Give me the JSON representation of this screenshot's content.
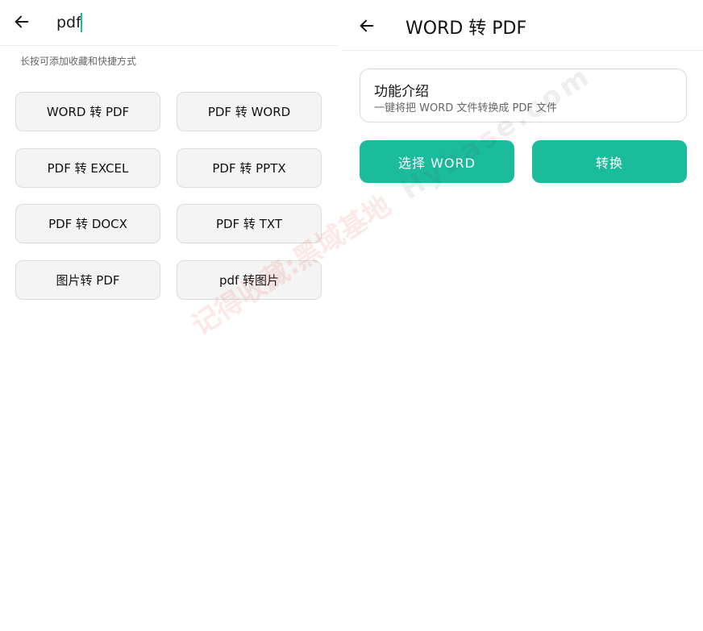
{
  "search": {
    "query": "pdf",
    "hint": "长按可添加收藏和快捷方式",
    "back_icon": "arrow-left-icon",
    "results": [
      {
        "label": "WORD 转 PDF"
      },
      {
        "label": "PDF 转 WORD"
      },
      {
        "label": "PDF 转 EXCEL"
      },
      {
        "label": "PDF 转 PPTX"
      },
      {
        "label": "PDF 转 DOCX"
      },
      {
        "label": "PDF 转 TXT"
      },
      {
        "label": "图片转 PDF"
      },
      {
        "label": "pdf 转图片"
      }
    ]
  },
  "converter": {
    "title": "WORD 转 PDF",
    "back_icon": "arrow-left-icon",
    "intro_title": "功能介绍",
    "intro_desc": "一键将把 WORD 文件转换成 PDF 文件",
    "select_label": "选择 WORD",
    "convert_label": "转换"
  },
  "watermark": {
    "text_cn": "记得收藏:黑域基地",
    "text_en": "Hybase.com"
  },
  "colors": {
    "accent": "#1abc9c",
    "button_bg": "#f4f4f4",
    "button_border": "#dcdcdc"
  }
}
